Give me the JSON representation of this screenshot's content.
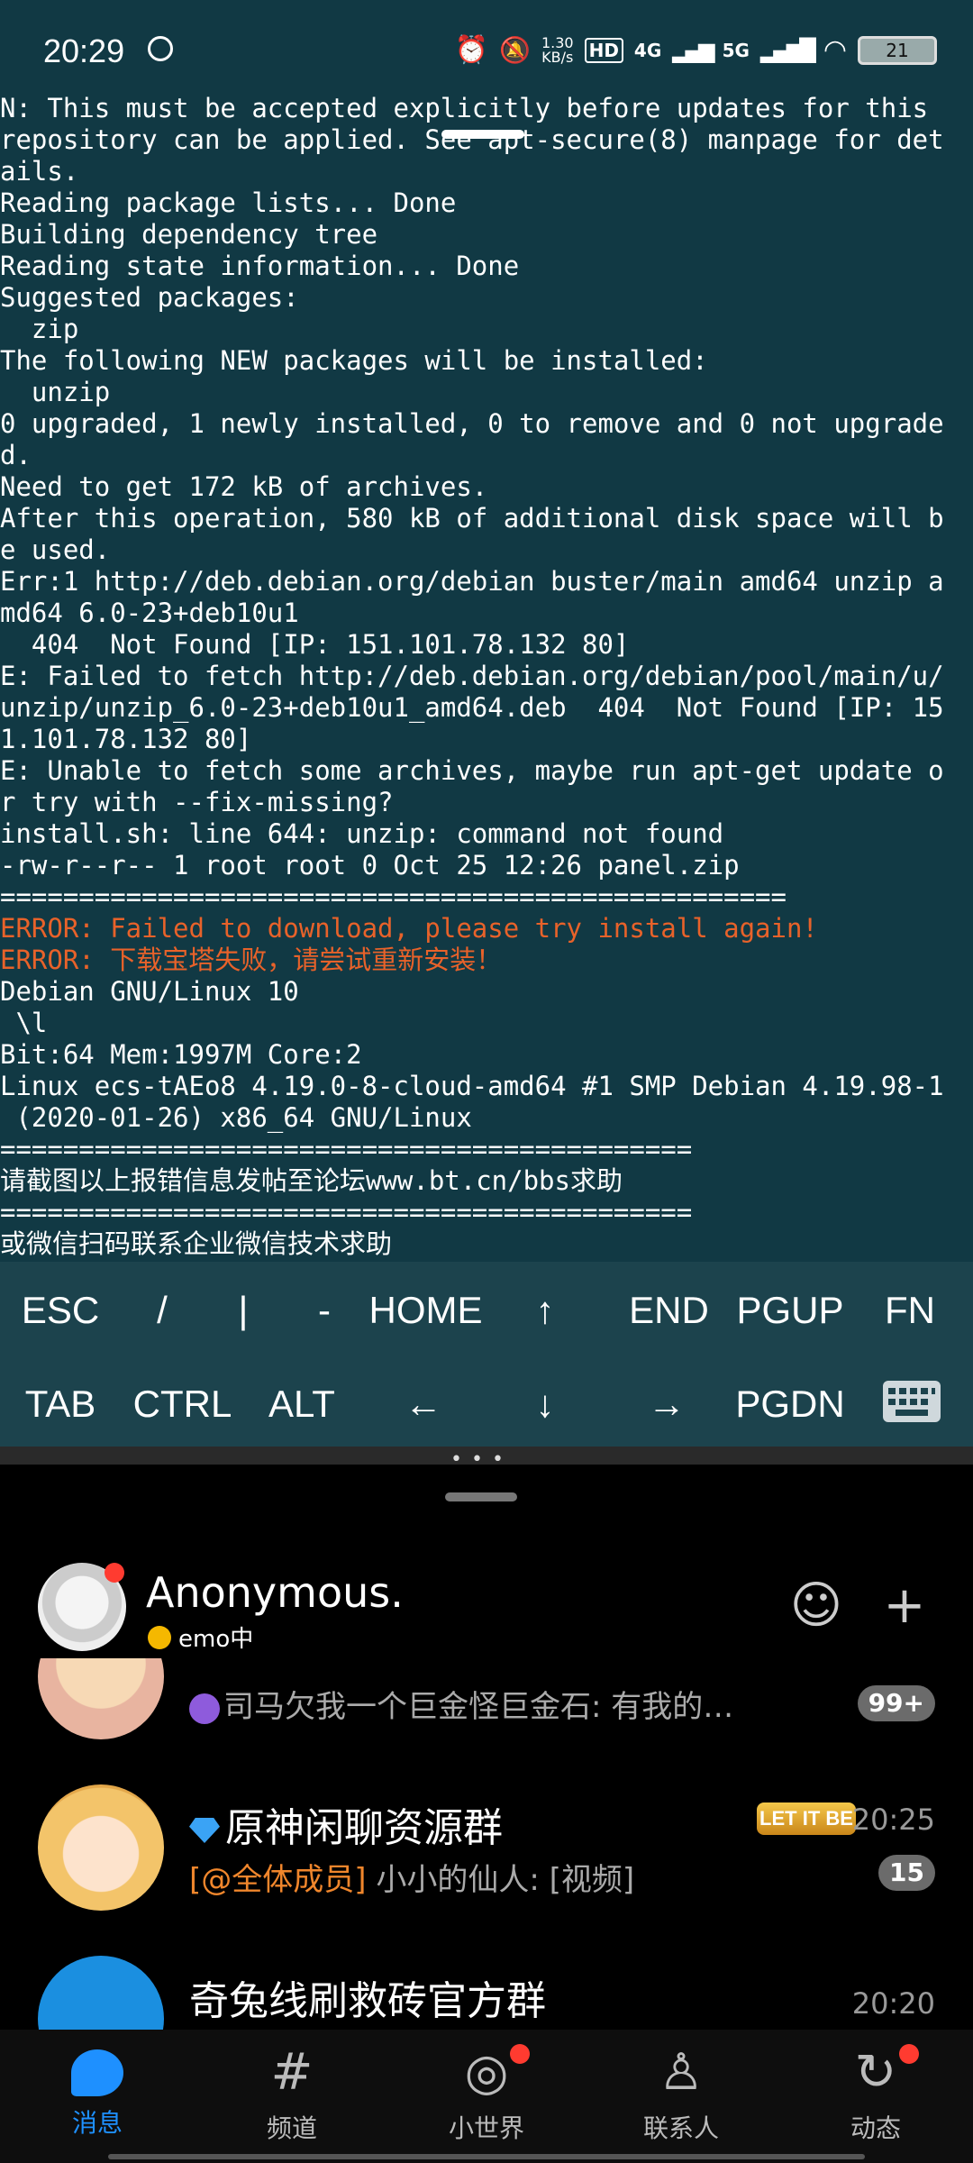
{
  "status_bar": {
    "time": "20:29",
    "speed_value": "1.30",
    "speed_unit": "KB/s",
    "hd": "HD",
    "net1": "4G",
    "net2": "5G",
    "battery": "21",
    "icons": [
      "sync-icon",
      "alarm-icon",
      "mute-icon",
      "signal-icon",
      "wifi-icon",
      "battery-icon"
    ]
  },
  "terminal": {
    "lines": [
      {
        "text": "N: This must be accepted explicitly before updates for this",
        "error": false
      },
      {
        "text": "repository can be applied. See apt-secure(8) manpage for det",
        "error": false
      },
      {
        "text": "ails.",
        "error": false
      },
      {
        "text": "Reading package lists... Done",
        "error": false
      },
      {
        "text": "Building dependency tree",
        "error": false
      },
      {
        "text": "Reading state information... Done",
        "error": false
      },
      {
        "text": "Suggested packages:",
        "error": false
      },
      {
        "text": "  zip",
        "error": false
      },
      {
        "text": "The following NEW packages will be installed:",
        "error": false
      },
      {
        "text": "  unzip",
        "error": false
      },
      {
        "text": "0 upgraded, 1 newly installed, 0 to remove and 0 not upgrade",
        "error": false
      },
      {
        "text": "d.",
        "error": false
      },
      {
        "text": "Need to get 172 kB of archives.",
        "error": false
      },
      {
        "text": "After this operation, 580 kB of additional disk space will b",
        "error": false
      },
      {
        "text": "e used.",
        "error": false
      },
      {
        "text": "Err:1 http://deb.debian.org/debian buster/main amd64 unzip a",
        "error": false
      },
      {
        "text": "md64 6.0-23+deb10u1",
        "error": false
      },
      {
        "text": "  404  Not Found [IP: 151.101.78.132 80]",
        "error": false
      },
      {
        "text": "E: Failed to fetch http://deb.debian.org/debian/pool/main/u/",
        "error": false
      },
      {
        "text": "unzip/unzip_6.0-23+deb10u1_amd64.deb  404  Not Found [IP: 15",
        "error": false
      },
      {
        "text": "1.101.78.132 80]",
        "error": false
      },
      {
        "text": "E: Unable to fetch some archives, maybe run apt-get update o",
        "error": false
      },
      {
        "text": "r try with --fix-missing?",
        "error": false
      },
      {
        "text": "install.sh: line 644: unzip: command not found",
        "error": false
      },
      {
        "text": "-rw-r--r-- 1 root root 0 Oct 25 12:26 panel.zip",
        "error": false
      },
      {
        "text": "==================================================",
        "error": false
      },
      {
        "text": "ERROR: Failed to download, please try install again!",
        "error": true
      },
      {
        "text": "ERROR: 下载宝塔失败，请尝试重新安装！",
        "error": true
      },
      {
        "text": "Debian GNU/Linux 10",
        "error": false
      },
      {
        "text": " \\l",
        "error": false
      },
      {
        "text": "Bit:64 Mem:1997M Core:2",
        "error": false
      },
      {
        "text": "Linux ecs-tAEo8 4.19.0-8-cloud-amd64 #1 SMP Debian 4.19.98-1",
        "error": false
      },
      {
        "text": " (2020-01-26) x86_64 GNU/Linux",
        "error": false
      },
      {
        "text": "============================================",
        "error": false
      },
      {
        "text": "请截图以上报错信息发帖至论坛www.bt.cn/bbs求助",
        "error": false
      },
      {
        "text": "============================================",
        "error": false
      },
      {
        "text": "或微信扫码联系企业微信技术求助",
        "error": false
      }
    ]
  },
  "extra_keys": {
    "row1": [
      "ESC",
      "/",
      "|",
      "-",
      "HOME",
      "↑",
      "END",
      "PGUP",
      "FN"
    ],
    "row2": [
      "TAB",
      "CTRL",
      "ALT",
      "←",
      "↓",
      "→",
      "PGDN"
    ]
  },
  "qq": {
    "username": "Anonymous.",
    "mood": "emo中",
    "chats": [
      {
        "title": "",
        "preview": "司马欠我一个巨金怪巨金石: 有我的…",
        "time": "",
        "badge": "99+"
      },
      {
        "title": "原神闲聊资源群",
        "mention": "[@全体成员]",
        "preview": " 小小的仙人: [视频]",
        "time": "20:25",
        "badge": "15",
        "tag": "LET IT BE"
      },
      {
        "title": "奇兔线刷救砖官方群",
        "preview": "",
        "time": "20:20",
        "badge": ""
      }
    ],
    "nav": [
      {
        "label": "消息",
        "icon": "message-icon",
        "active": true
      },
      {
        "label": "频道",
        "icon": "channel-icon",
        "active": false
      },
      {
        "label": "小世界",
        "icon": "world-icon",
        "active": false
      },
      {
        "label": "联系人",
        "icon": "contacts-icon",
        "active": false
      },
      {
        "label": "动态",
        "icon": "moments-icon",
        "active": false
      }
    ]
  },
  "colors": {
    "terminal_bg": "#113944",
    "error_text": "#e8622a",
    "accent": "#1e90ff"
  }
}
